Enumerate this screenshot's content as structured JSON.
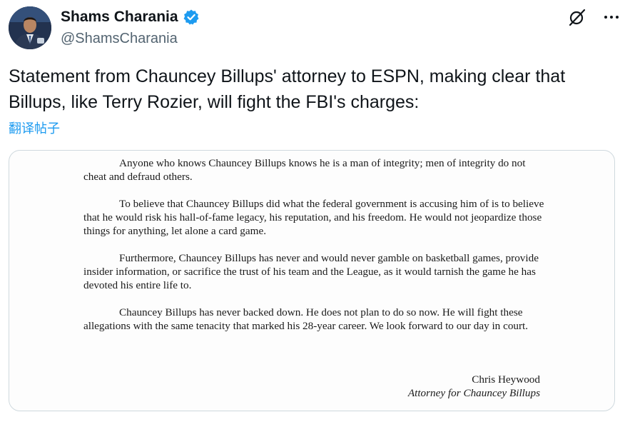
{
  "author": {
    "display_name": "Shams Charania",
    "handle": "@ShamsCharania",
    "verified": true
  },
  "icons": {
    "verified": "verified-badge-icon",
    "grok": "grok-icon",
    "more": "more-horizontal-icon"
  },
  "tweet": {
    "text": "Statement from Chauncey Billups' attorney to ESPN, making clear that Billups, like Terry Rozier, will fight the FBI's charges:",
    "translate_label": "翻译帖子"
  },
  "statement": {
    "paragraphs": [
      "Anyone who knows Chauncey Billups knows he is a man of integrity; men of integrity do not cheat and defraud others.",
      "To believe that Chauncey Billups did what the federal government is accusing him of is to believe that he would risk his hall-of-fame legacy, his reputation, and his freedom. He would not jeopardize those things for anything, let alone a card game.",
      "Furthermore, Chauncey Billups has never and would never gamble on basketball games, provide insider information, or sacrifice the trust of his team and the League, as it would tarnish the game he has devoted his entire life to.",
      "Chauncey Billups has never backed down. He does not plan to do so now. He will fight these allegations with the same tenacity that marked his 28-year career. We look forward to our day in court."
    ],
    "signer_name": "Chris Heywood",
    "signer_title": "Attorney for Chauncey Billups"
  },
  "colors": {
    "text_primary": "#0f1419",
    "text_secondary": "#536471",
    "accent": "#1d9bf0",
    "border": "#cfd9de"
  }
}
